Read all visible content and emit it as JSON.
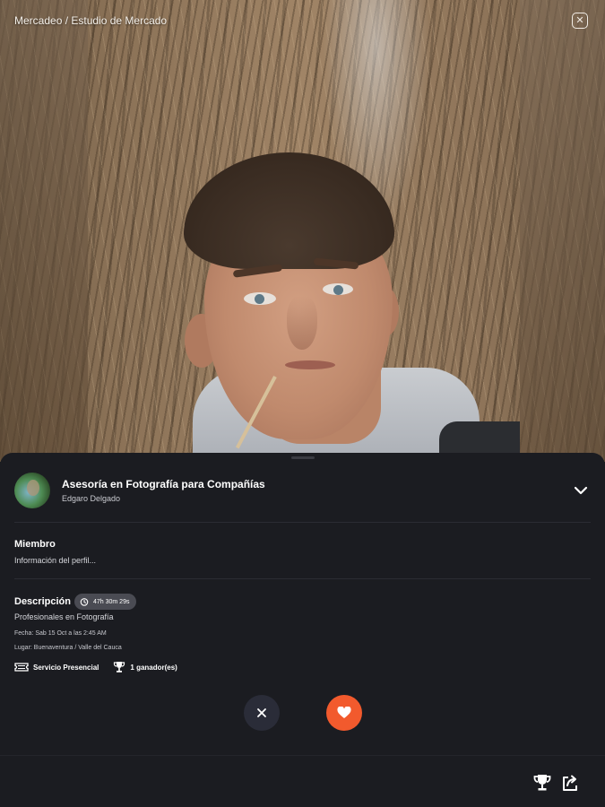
{
  "breadcrumb": "Mercadeo / Estudio de Mercado",
  "icons": {
    "close": "close-icon",
    "chevron": "chevron-down-icon",
    "timer": "timer-icon",
    "ticket": "ticket-icon",
    "trophy": "trophy-icon",
    "heart": "heart-icon",
    "share": "share-icon"
  },
  "header": {
    "title": "Asesoría en Fotografía para Compañías",
    "author": "Edgaro Delgado"
  },
  "member": {
    "label": "Miembro",
    "text": "Información del perfil..."
  },
  "description": {
    "label": "Descripción",
    "timer": "47h 30m 29s",
    "text": "Profesionales en Fotografía",
    "date": "Fecha: Sab 15 Oct a las 2:45 AM",
    "place": "Lugar: Buenaventura / Valle del Cauca"
  },
  "tags": {
    "service": "Servicio Presencial",
    "winners": "1 ganador(es)"
  },
  "colors": {
    "background": "#1b1c21",
    "accent": "#f25a2d",
    "dismiss": "#2a2c38",
    "timer_pill": "#4a4b53"
  }
}
